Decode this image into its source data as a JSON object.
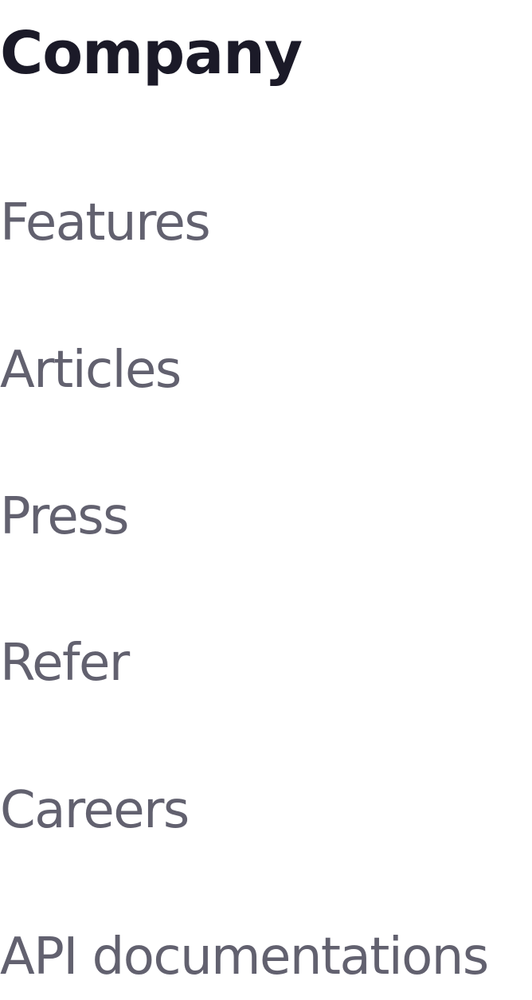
{
  "colors": {
    "heading": "#1b1a28",
    "link": "#62616f",
    "background": "#ffffff"
  },
  "footer": {
    "title": "Company",
    "links": [
      {
        "label": "Features"
      },
      {
        "label": "Articles"
      },
      {
        "label": "Press"
      },
      {
        "label": "Refer"
      },
      {
        "label": "Careers"
      },
      {
        "label": "API documentations"
      }
    ]
  }
}
